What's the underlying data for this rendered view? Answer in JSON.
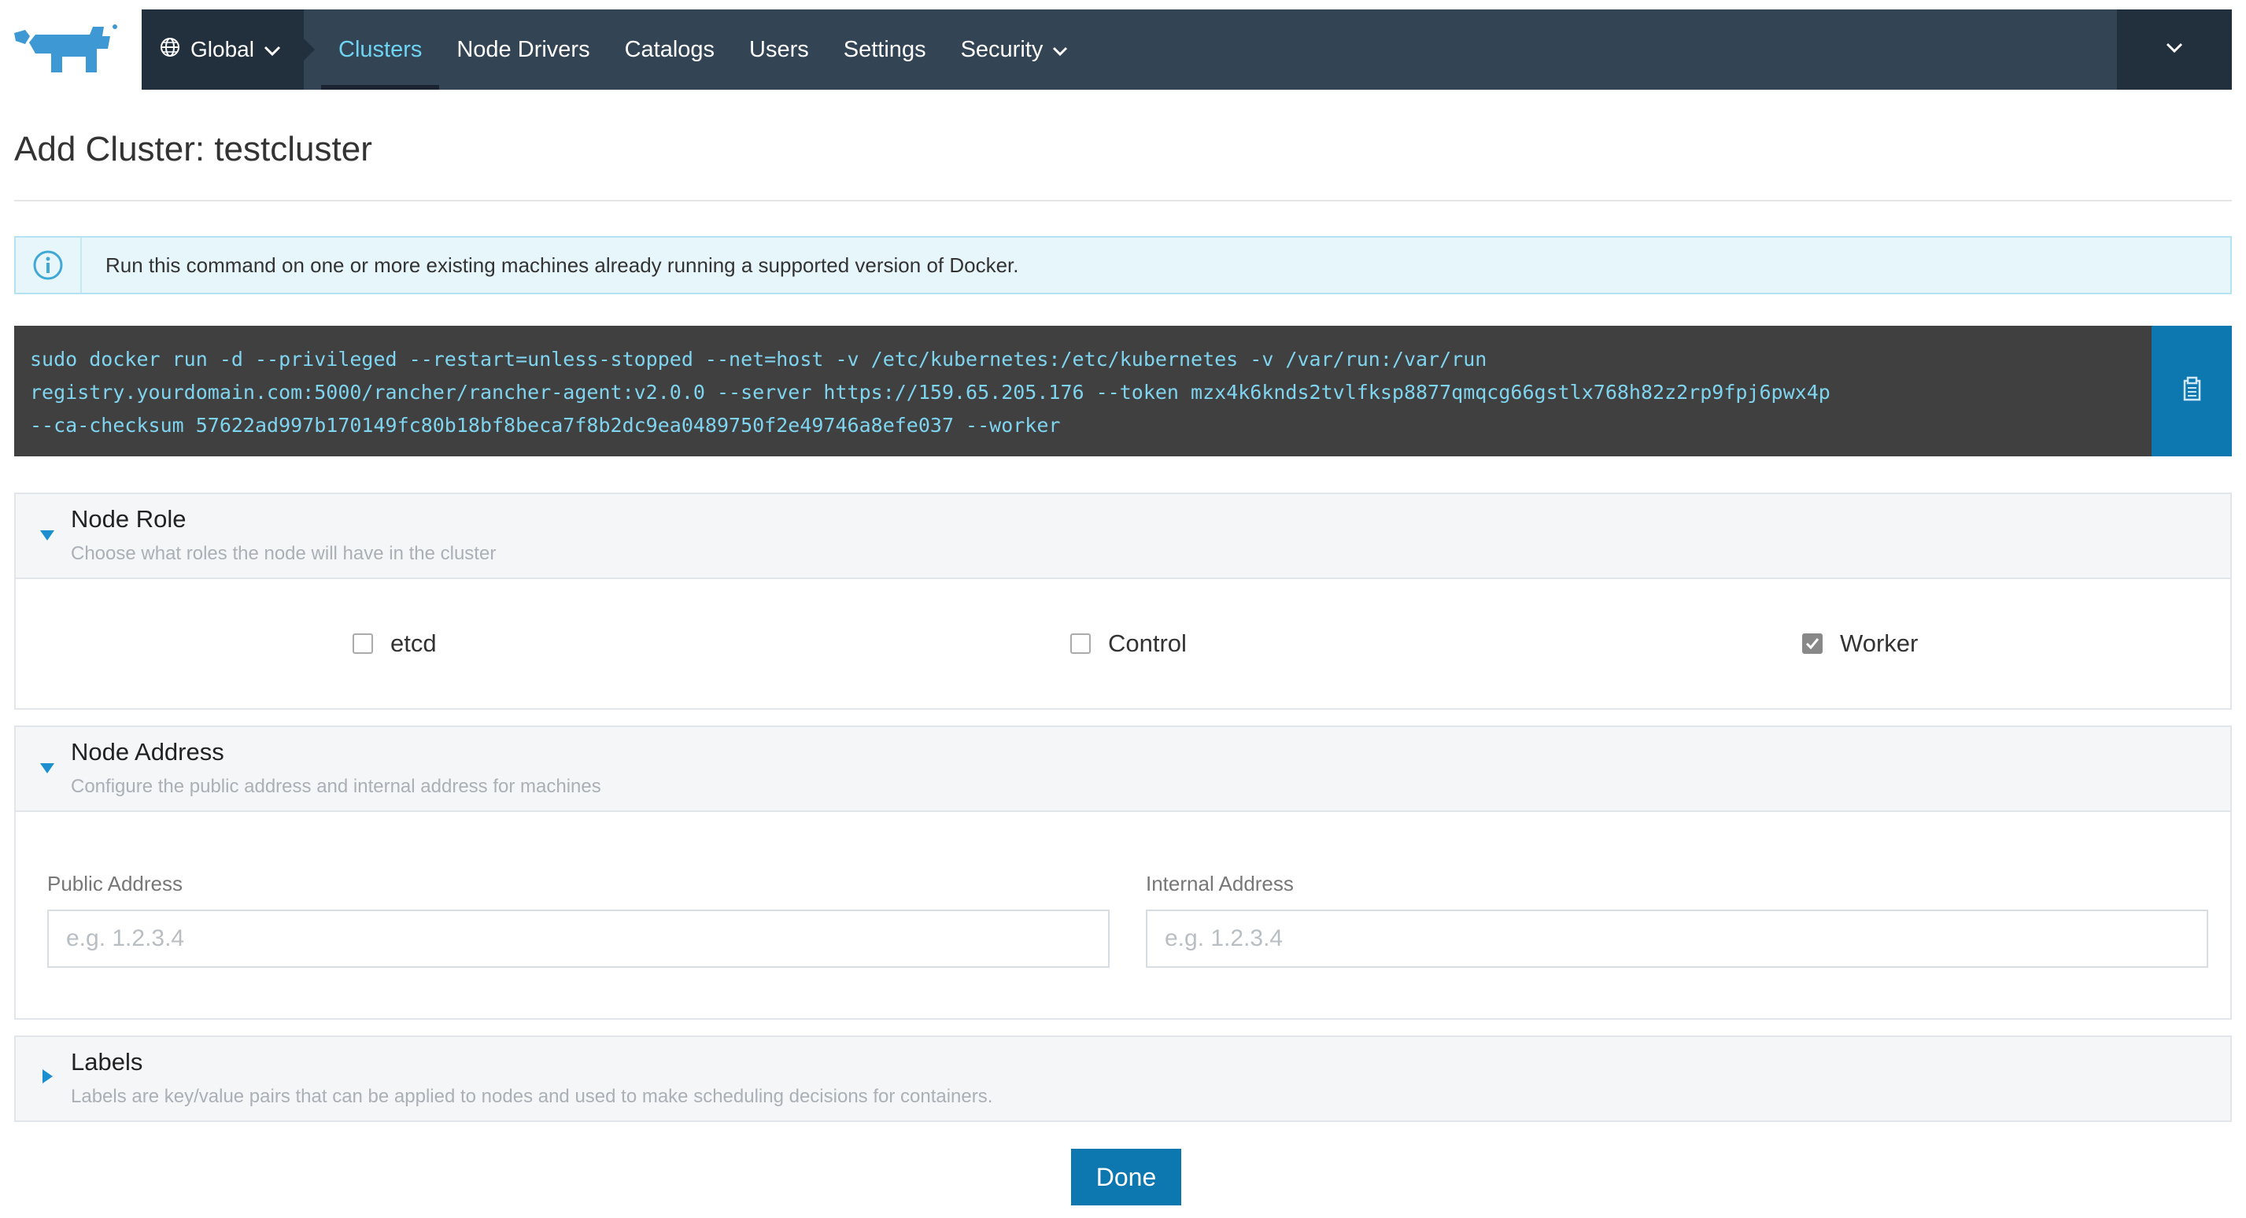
{
  "nav": {
    "global_label": "Global",
    "items": [
      {
        "label": "Clusters",
        "active": true
      },
      {
        "label": "Node Drivers"
      },
      {
        "label": "Catalogs"
      },
      {
        "label": "Users"
      },
      {
        "label": "Settings"
      },
      {
        "label": "Security"
      }
    ]
  },
  "page": {
    "title": "Add Cluster: testcluster"
  },
  "info": {
    "text": "Run this command on one or more existing machines already running a supported version of Docker."
  },
  "command": {
    "lines": [
      "sudo docker run -d --privileged --restart=unless-stopped --net=host -v /etc/kubernetes:/etc/kubernetes -v /var/run:/var/run",
      "registry.yourdomain.com:5000/rancher/rancher-agent:v2.0.0 --server https://159.65.205.176 --token mzx4k6knds2tvlfksp8877qmqcg66gstlx768h82z2rp9fpj6pwx4p",
      "--ca-checksum 57622ad997b170149fc80b18bf8beca7f8b2dc9ea0489750f2e49746a8efe037 --worker"
    ]
  },
  "node_role": {
    "title": "Node Role",
    "description": "Choose what roles the node will have in the cluster",
    "roles": [
      {
        "label": "etcd",
        "checked": false
      },
      {
        "label": "Control",
        "checked": false
      },
      {
        "label": "Worker",
        "checked": true
      }
    ]
  },
  "node_address": {
    "title": "Node Address",
    "description": "Configure the public address and internal address for machines",
    "public_label": "Public Address",
    "public_placeholder": "e.g. 1.2.3.4",
    "public_value": "",
    "internal_label": "Internal Address",
    "internal_placeholder": "e.g. 1.2.3.4",
    "internal_value": ""
  },
  "labels": {
    "title": "Labels",
    "description": "Labels are key/value pairs that can be applied to nodes and used to make scheduling decisions for containers."
  },
  "done_label": "Done",
  "colors": {
    "nav_bg": "#334455",
    "nav_dark": "#222f3d",
    "accent": "#0d77b0",
    "active_link": "#6fd3f2",
    "command_bg": "#404040",
    "command_text": "#7fd4ef"
  },
  "icons": {
    "logo": "rancher-logo",
    "global": "globe-icon",
    "info": "info-icon",
    "copy": "clipboard-icon"
  }
}
